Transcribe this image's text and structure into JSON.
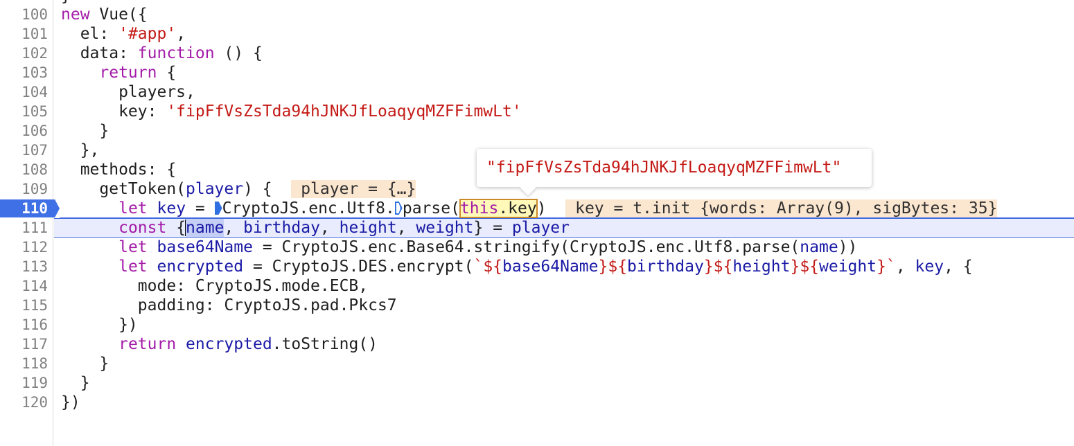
{
  "editor": {
    "lines": [
      {
        "n": "100"
      },
      {
        "n": "101"
      },
      {
        "n": "102"
      },
      {
        "n": "103"
      },
      {
        "n": "104"
      },
      {
        "n": "105"
      },
      {
        "n": "106"
      },
      {
        "n": "107"
      },
      {
        "n": "108"
      },
      {
        "n": "109"
      },
      {
        "n": "110"
      },
      {
        "n": "111"
      },
      {
        "n": "112"
      },
      {
        "n": "113"
      },
      {
        "n": "114"
      },
      {
        "n": "115"
      },
      {
        "n": "116"
      },
      {
        "n": "117"
      },
      {
        "n": "118"
      },
      {
        "n": "119"
      },
      {
        "n": "120"
      }
    ],
    "code": {
      "l100_a": "new",
      "l100_b": " Vue({",
      "l101_a": "  el: ",
      "l101_b": "'#app'",
      "l101_c": ",",
      "l102_a": "  data: ",
      "l102_b": "function",
      "l102_c": " () {",
      "l103_a": "    ",
      "l103_b": "return",
      "l103_c": " {",
      "l104": "      players,",
      "l105_a": "      key: ",
      "l105_b": "'fipFfVsZsTda94hJNKJfLoaqyqMZFFimwLt'",
      "l106": "    }",
      "l107": "  },",
      "l108": "  methods: {",
      "l109_a": "    getToken(",
      "l109_b": "player",
      "l109_c": ") {  ",
      "l109_inline": " player = {…}",
      "l110_a": "      ",
      "l110_b": "let",
      "l110_c": " ",
      "l110_d": "key",
      "l110_e": " = ",
      "l110_f": "CryptoJS.enc.Utf8.",
      "l110_g": "parse(",
      "l110_h": "this",
      "l110_i": ".key",
      "l110_j": ")  ",
      "l110_inline": " key = t.init {words: Array(9), sigBytes: 35}",
      "l111_a": "      ",
      "l111_b": "const",
      "l111_c": " {",
      "l111_d": "name",
      "l111_e": ", ",
      "l111_f": "birthday",
      "l111_g": ", ",
      "l111_h": "height",
      "l111_i": ", ",
      "l111_j": "weight",
      "l111_k": "} = ",
      "l111_l": "player",
      "l112_a": "      ",
      "l112_b": "let",
      "l112_c": " ",
      "l112_d": "base64Name",
      "l112_e": " = CryptoJS.enc.Base64.stringify(CryptoJS.enc.Utf8.parse(",
      "l112_f": "name",
      "l112_g": "))",
      "l113_a": "      ",
      "l113_b": "let",
      "l113_c": " ",
      "l113_d": "encrypted",
      "l113_e": " = CryptoJS.DES.encrypt(",
      "l113_f": "`${",
      "l113_g": "base64Name",
      "l113_h": "}${",
      "l113_i": "birthday",
      "l113_j": "}${",
      "l113_k": "height",
      "l113_l": "}${",
      "l113_m": "weight",
      "l113_n": "}`",
      "l113_o": ", ",
      "l113_p": "key",
      "l113_q": ", {",
      "l114": "        mode: CryptoJS.mode.ECB,",
      "l115": "        padding: CryptoJS.pad.Pkcs7",
      "l116": "      })",
      "l117_a": "      ",
      "l117_b": "return",
      "l117_c": " ",
      "l117_d": "encrypted",
      "l117_e": ".toString()",
      "l118": "    }",
      "l119": "  }",
      "l120": "})"
    },
    "active_breakpoint_line": "110"
  },
  "tooltip": {
    "value": "\"fipFfVsZsTda94hJNKJfLoaqyqMZFFimwLt\""
  },
  "colors": {
    "keyword": "#a31ba8",
    "string": "#c41a16",
    "variable": "#1a1aa6",
    "breakpoint": "#3f70e6",
    "inline_value_bg": "#fbe6d0"
  }
}
